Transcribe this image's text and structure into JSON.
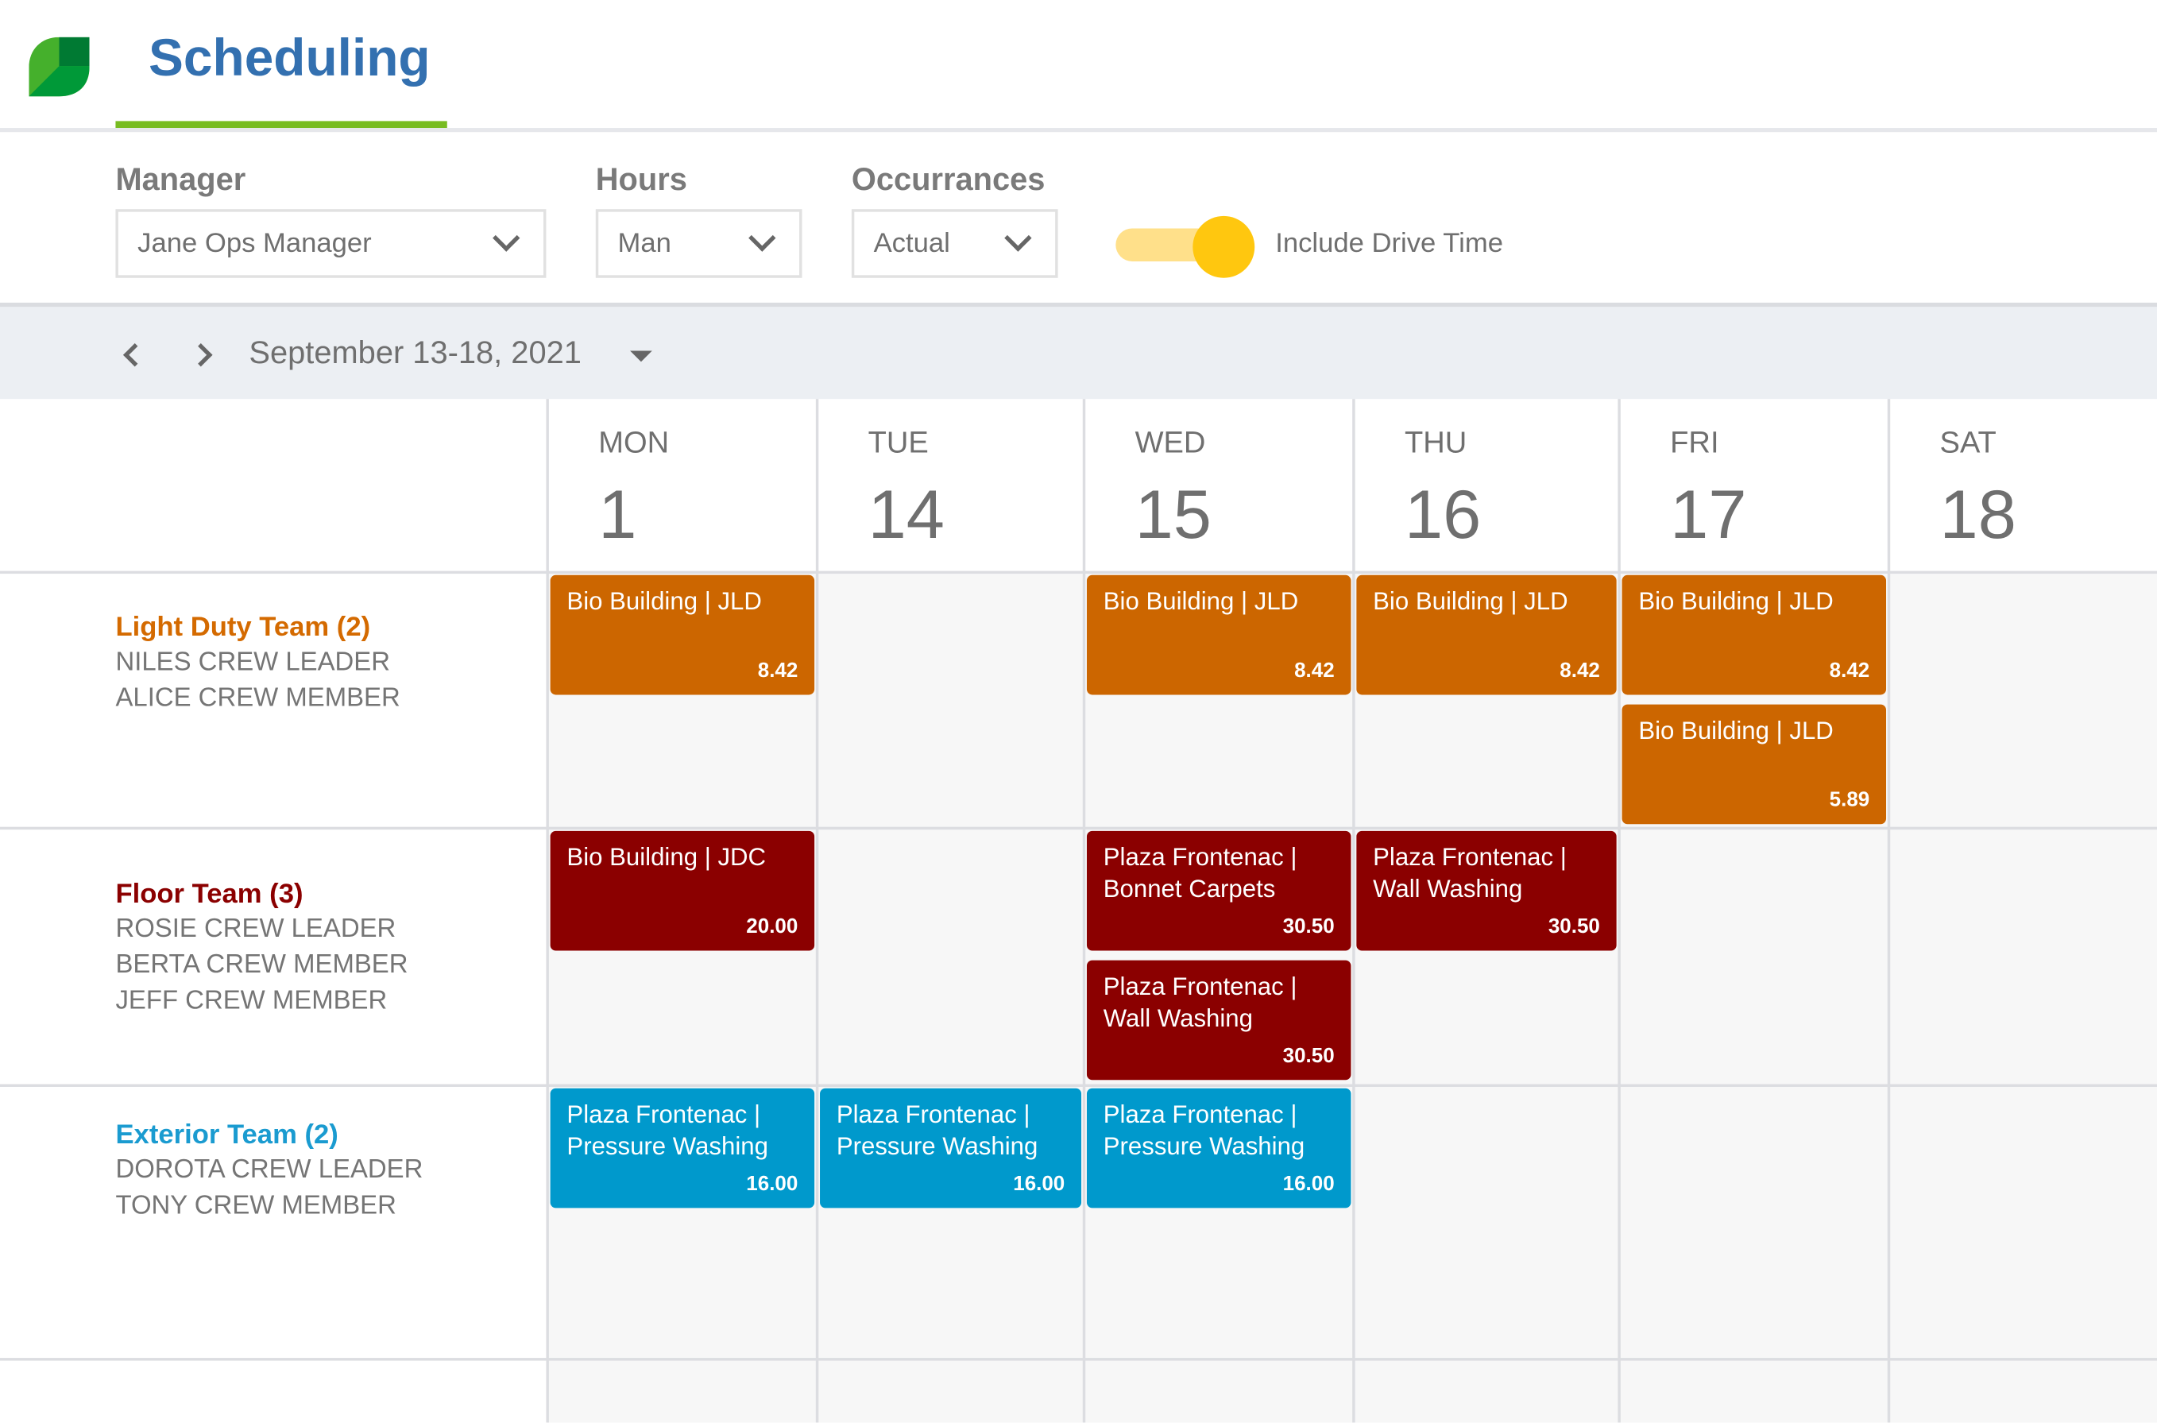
{
  "app": {
    "title": "Scheduling",
    "logo": "leaf-logo"
  },
  "filters": {
    "manager": {
      "label": "Manager",
      "value": "Jane Ops Manager"
    },
    "hours": {
      "label": "Hours",
      "value": "Man"
    },
    "occurrences": {
      "label": "Occurrances",
      "value": "Actual"
    },
    "drive_time": {
      "label": "Include Drive Time",
      "on": true
    }
  },
  "date_nav": {
    "range": "September 13-18, 2021",
    "prev_icon": "chevron-left-icon",
    "next_icon": "chevron-right-icon"
  },
  "days": [
    {
      "dow": "MON",
      "num": "1"
    },
    {
      "dow": "TUE",
      "num": "14"
    },
    {
      "dow": "WED",
      "num": "15"
    },
    {
      "dow": "THU",
      "num": "16"
    },
    {
      "dow": "FRI",
      "num": "17"
    },
    {
      "dow": "SAT",
      "num": "18"
    }
  ],
  "colors": {
    "light_duty": "#CC6600",
    "floor": "#8B0000",
    "exterior": "#0099CC",
    "accent": "#3370B0",
    "underline": "#78BC22",
    "toggle": "#FFC70F"
  },
  "teams": [
    {
      "name": "Light Duty Team (2)",
      "color": "#D46A00",
      "members": [
        "NILES CREW LEADER",
        "ALICE CREW MEMBER"
      ],
      "jobs": [
        {
          "day": 0,
          "slot": 0,
          "title": "Bio Building | JLD",
          "hours": "8.42"
        },
        {
          "day": 2,
          "slot": 0,
          "title": "Bio Building | JLD",
          "hours": "8.42"
        },
        {
          "day": 3,
          "slot": 0,
          "title": "Bio Building | JLD",
          "hours": "8.42"
        },
        {
          "day": 4,
          "slot": 0,
          "title": "Bio Building | JLD",
          "hours": "8.42"
        },
        {
          "day": 4,
          "slot": 1,
          "title": "Bio Building | JLD",
          "hours": "5.89"
        }
      ]
    },
    {
      "name": "Floor Team (3)",
      "color": "#8B0000",
      "members": [
        "ROSIE CREW LEADER",
        "BERTA CREW MEMBER",
        "JEFF CREW MEMBER"
      ],
      "jobs": [
        {
          "day": 0,
          "slot": 0,
          "title": "Bio Building | JDC",
          "hours": "20.00"
        },
        {
          "day": 2,
          "slot": 0,
          "title": "Plaza Frontenac | Bonnet Carpets",
          "hours": "30.50"
        },
        {
          "day": 2,
          "slot": 1,
          "title": "Plaza Frontenac | Wall Washing",
          "hours": "30.50"
        },
        {
          "day": 3,
          "slot": 0,
          "title": "Plaza Frontenac | Wall Washing",
          "hours": "30.50"
        }
      ]
    },
    {
      "name": "Exterior Team (2)",
      "color": "#1A9BD0",
      "members": [
        "DOROTA CREW LEADER",
        "TONY CREW MEMBER"
      ],
      "jobs": [
        {
          "day": 0,
          "slot": 0,
          "title": "Plaza Frontenac | Pressure Washing",
          "hours": "16.00"
        },
        {
          "day": 1,
          "slot": 0,
          "title": "Plaza Frontenac | Pressure Washing",
          "hours": "16.00"
        },
        {
          "day": 2,
          "slot": 0,
          "title": "Plaza Frontenac | Pressure Washing",
          "hours": "16.00"
        }
      ]
    }
  ]
}
